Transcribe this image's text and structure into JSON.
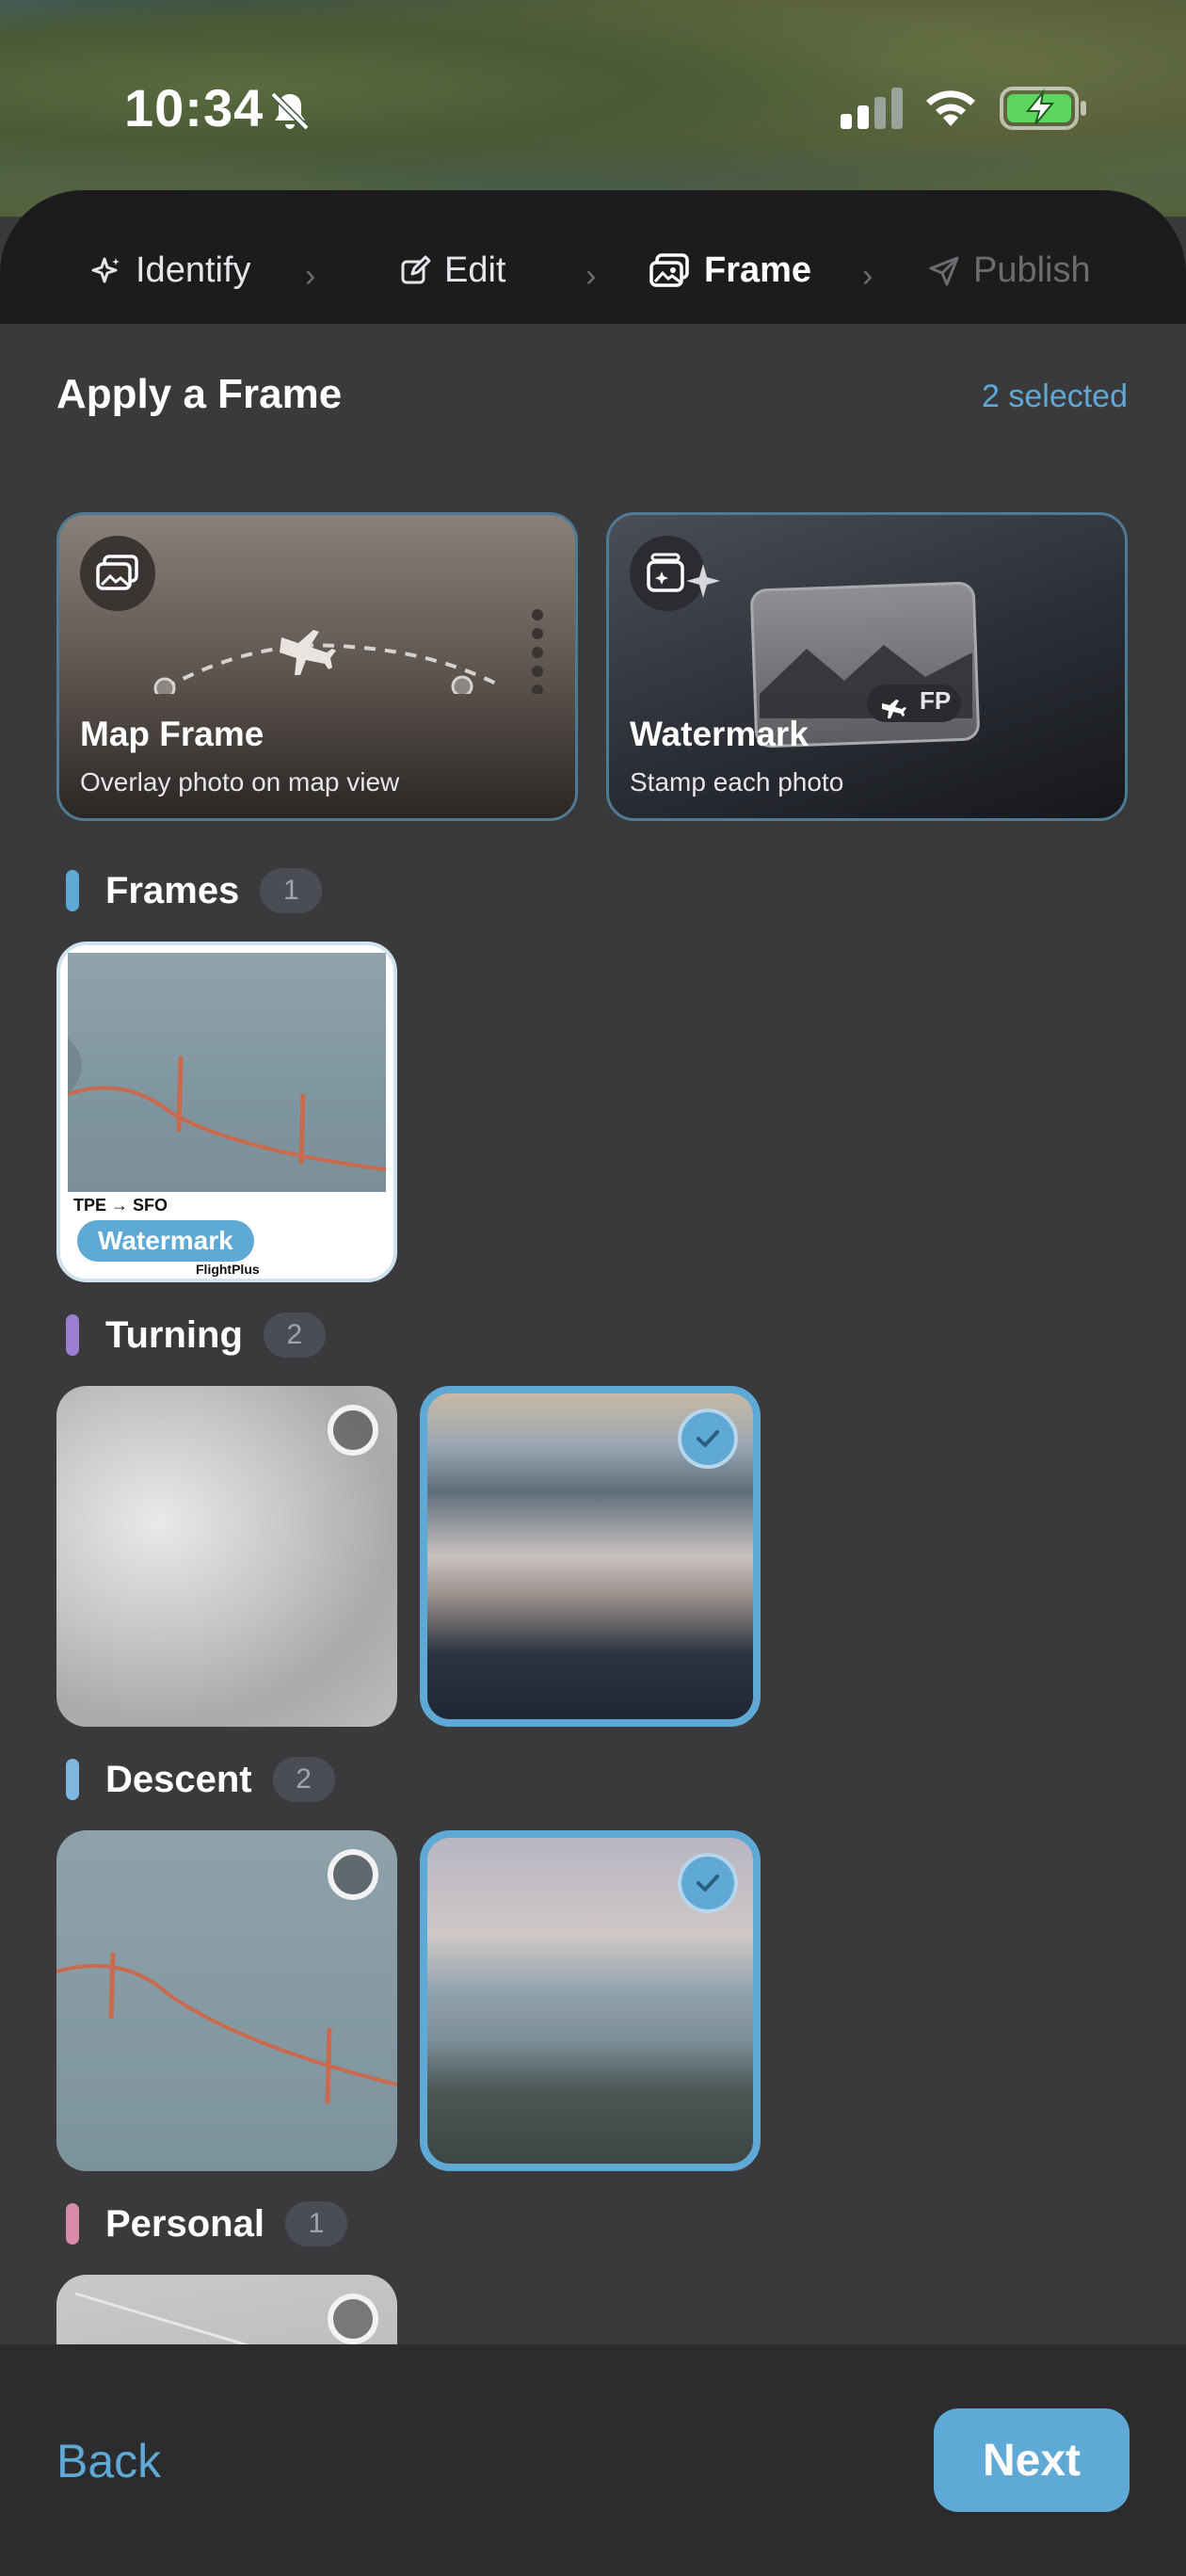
{
  "status_bar": {
    "time": "10:34"
  },
  "steps": [
    {
      "label": "Identify",
      "icon": "sparkle-icon"
    },
    {
      "label": "Edit",
      "icon": "edit-icon"
    },
    {
      "label": "Frame",
      "icon": "frame-icon"
    },
    {
      "label": "Publish",
      "icon": "send-icon"
    }
  ],
  "header": {
    "title": "Apply a Frame",
    "selected": "2 selected"
  },
  "cards": {
    "map_frame": {
      "title": "Map Frame",
      "subtitle": "Overlay photo on map view"
    },
    "watermark": {
      "title": "Watermark",
      "subtitle": "Stamp each photo",
      "badge": "FP"
    }
  },
  "sections": [
    {
      "label": "Frames",
      "count": "1",
      "color": "#5fa9d6"
    },
    {
      "label": "Turning",
      "count": "2",
      "color": "#9b7fd4"
    },
    {
      "label": "Descent",
      "count": "2",
      "color": "#7fb6e0"
    },
    {
      "label": "Personal",
      "count": "1",
      "color": "#d98aa8"
    }
  ],
  "frame_preview": {
    "route": "TPE → SFO",
    "tag": "Watermark",
    "brand": "FlightPlus"
  },
  "footer": {
    "back": "Back",
    "next": "Next"
  },
  "colors": {
    "accent": "#5fa9d6",
    "sheet": "#3a3a3c",
    "bar": "#1c1c1e"
  }
}
